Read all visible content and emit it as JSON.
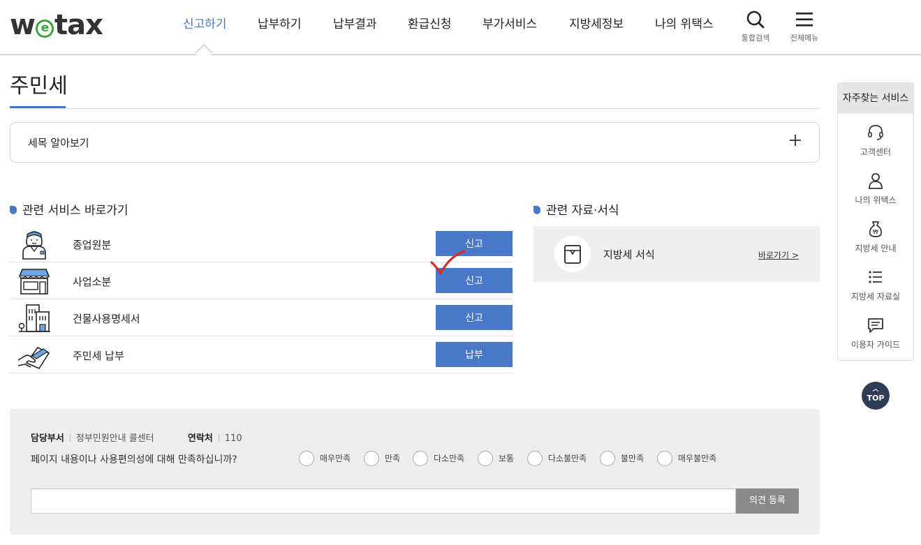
{
  "header": {
    "logo": {
      "pre": "w",
      "mid": "e",
      "post": "tax"
    },
    "nav": [
      "신고하기",
      "납부하기",
      "납부결과",
      "환급신청",
      "부가서비스",
      "지방세정보",
      "나의 위택스"
    ],
    "search_label": "통합검색",
    "menu_label": "전체메뉴"
  },
  "page": {
    "title": "주민세"
  },
  "accordion": {
    "label": "세목 알아보기"
  },
  "services": {
    "title": "관련 서비스 바로가기",
    "items": [
      {
        "name": "종업원분",
        "button": "신고",
        "icon": "worker-icon"
      },
      {
        "name": "사업소분",
        "button": "신고",
        "icon": "store-icon"
      },
      {
        "name": "건물사용명세서",
        "button": "신고",
        "icon": "building-icon"
      },
      {
        "name": "주민세 납부",
        "button": "납부",
        "icon": "card-payment-icon"
      }
    ]
  },
  "forms": {
    "title": "관련 자료·서식",
    "item_label": "지방세 서식",
    "link": "바로가기 >"
  },
  "quick": {
    "title": "자주찾는 서비스",
    "items": [
      {
        "label": "고객센터",
        "icon": "headset-icon"
      },
      {
        "label": "나의 위택스",
        "icon": "person-icon"
      },
      {
        "label": "지방세 안내",
        "icon": "money-bag-icon"
      },
      {
        "label": "지방세 자료실",
        "icon": "list-icon"
      },
      {
        "label": "이용자 가이드",
        "icon": "chat-icon"
      }
    ],
    "top": "TOP"
  },
  "survey": {
    "dept_label": "담당부서",
    "dept_value": "정부민원안내 콜센터",
    "contact_label": "연락처",
    "contact_value": "110",
    "question": "페이지 내용이나 사용편의성에 대해 만족하십니까?",
    "options": [
      "매우만족",
      "만족",
      "다소만족",
      "보통",
      "다소불만족",
      "불만족",
      "매우불만족"
    ],
    "submit": "의견 등록"
  },
  "colors": {
    "accent": "#4a78c8",
    "logo_e": "#3aa63a",
    "top_button": "#2e3d55",
    "check": "#d62b2b"
  }
}
